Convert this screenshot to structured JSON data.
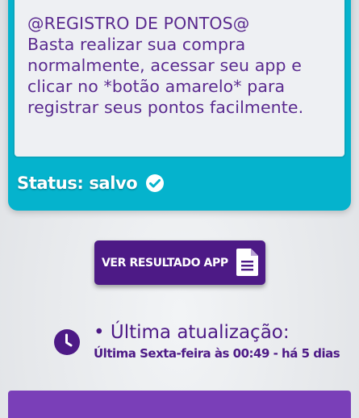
{
  "message": {
    "lines": [
      "@REGISTRO DE PONTOS@",
      "Basta realizar sua compra",
      "normalmente, acessar seu app e",
      "clicar no *botão amarelo* para",
      "registrar seus pontos facilmente."
    ]
  },
  "status": {
    "label": "Status: salvo",
    "icon": "check-circle-icon"
  },
  "result_button": {
    "label": "VER RESULTADO APP",
    "icon": "document-icon"
  },
  "update": {
    "icon": "clock-icon",
    "title": "• Última atualização:",
    "detail": "Última Sexta-feira às 00:49 - há 5 dias"
  },
  "colors": {
    "teal": "#05b3cd",
    "purple": "#4d1a86",
    "bar_purple": "#7a3fb8",
    "text_purple": "#5a2a8f"
  }
}
